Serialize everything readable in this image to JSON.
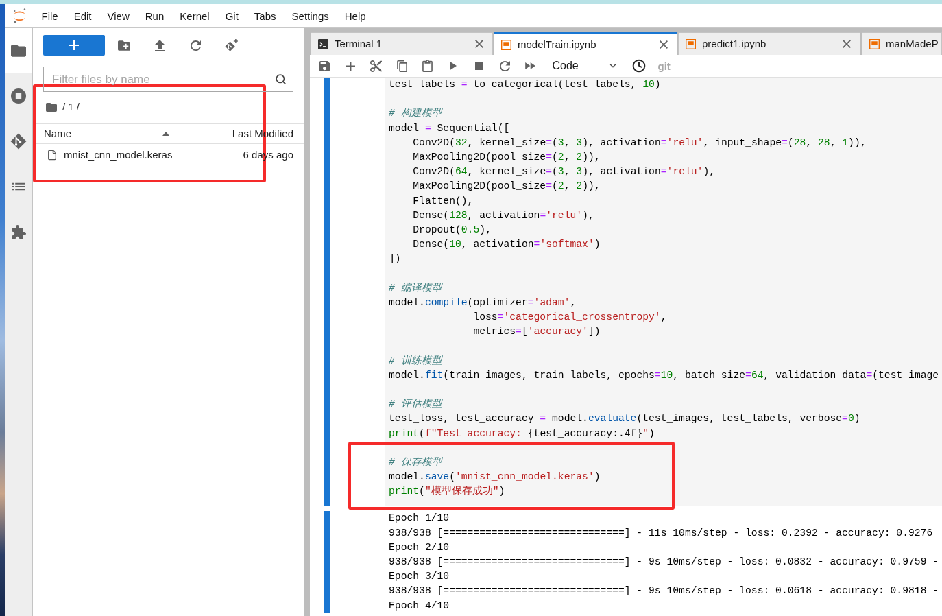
{
  "menu_bar": {
    "items": [
      "File",
      "Edit",
      "View",
      "Run",
      "Kernel",
      "Git",
      "Tabs",
      "Settings",
      "Help"
    ]
  },
  "activity_bar": {
    "items": [
      {
        "kind": "files",
        "selected": true
      },
      {
        "kind": "running",
        "selected": false
      },
      {
        "kind": "git",
        "selected": false
      },
      {
        "kind": "table_of_contents",
        "selected": false
      },
      {
        "kind": "extensions",
        "selected": false
      }
    ]
  },
  "file_browser": {
    "toolbar": [
      {
        "kind": "new_launcher"
      },
      {
        "kind": "new_folder"
      },
      {
        "kind": "upload"
      },
      {
        "kind": "refresh"
      },
      {
        "kind": "git_clone"
      }
    ],
    "filter": {
      "placeholder": "Filter files by name"
    },
    "path": "/ 1 /",
    "columns": [
      {
        "label": "Name",
        "sorted": true
      },
      {
        "label": "Last Modified",
        "sorted": false
      }
    ],
    "files": [
      {
        "name": "mnist_cnn_model.keras",
        "modified": "6 days ago",
        "selected": false
      }
    ]
  },
  "tabs": [
    {
      "kind": "terminal",
      "label": "Terminal 1",
      "selected": false,
      "closable": true
    },
    {
      "kind": "notebook",
      "label": "modelTrain.ipynb",
      "selected": true,
      "closable": true
    },
    {
      "kind": "notebook",
      "label": "predict1.ipynb",
      "selected": false,
      "closable": true
    },
    {
      "kind": "notebook",
      "label": "manMadeP",
      "selected": false,
      "closable": false
    }
  ],
  "notebook_toolbar": {
    "buttons": [
      {
        "kind": "save"
      },
      {
        "kind": "insert"
      },
      {
        "kind": "cut"
      },
      {
        "kind": "copy"
      },
      {
        "kind": "paste"
      },
      {
        "kind": "run"
      },
      {
        "kind": "interrupt"
      },
      {
        "kind": "restart"
      },
      {
        "kind": "run_all"
      }
    ],
    "cell_type": "Code",
    "extras": [
      {
        "kind": "history"
      },
      {
        "kind": "diff",
        "label": "git"
      }
    ]
  },
  "notebook": {
    "cells": [
      {
        "active": true,
        "input": [
          {
            "lines": [
              [
                {
                  "kind": "plain",
                  "text": "test_labels "
                },
                {
                  "kind": "operator",
                  "text": "="
                },
                {
                  "kind": "plain",
                  "text": " to_categorical(test_labels, "
                },
                {
                  "kind": "number",
                  "text": "10"
                },
                {
                  "kind": "plain",
                  "text": ")"
                }
              ]
            ]
          },
          {
            "lines": [
              [
                {
                  "kind": "comment",
                  "text": "# 构建模型"
                }
              ],
              [
                {
                  "kind": "plain",
                  "text": "model "
                },
                {
                  "kind": "operator",
                  "text": "="
                },
                {
                  "kind": "plain",
                  "text": " Sequential(["
                }
              ],
              [
                {
                  "kind": "plain",
                  "text": "    Conv2D("
                },
                {
                  "kind": "number",
                  "text": "32"
                },
                {
                  "kind": "plain",
                  "text": ", kernel_size"
                },
                {
                  "kind": "operator",
                  "text": "="
                },
                {
                  "kind": "plain",
                  "text": "("
                },
                {
                  "kind": "number",
                  "text": "3"
                },
                {
                  "kind": "plain",
                  "text": ", "
                },
                {
                  "kind": "number",
                  "text": "3"
                },
                {
                  "kind": "plain",
                  "text": "), activation"
                },
                {
                  "kind": "operator",
                  "text": "="
                },
                {
                  "kind": "string",
                  "text": "'relu'"
                },
                {
                  "kind": "plain",
                  "text": ", input_shape"
                },
                {
                  "kind": "operator",
                  "text": "="
                },
                {
                  "kind": "plain",
                  "text": "("
                },
                {
                  "kind": "number",
                  "text": "28"
                },
                {
                  "kind": "plain",
                  "text": ", "
                },
                {
                  "kind": "number",
                  "text": "28"
                },
                {
                  "kind": "plain",
                  "text": ", "
                },
                {
                  "kind": "number",
                  "text": "1"
                },
                {
                  "kind": "plain",
                  "text": ")),"
                }
              ],
              [
                {
                  "kind": "plain",
                  "text": "    MaxPooling2D(pool_size"
                },
                {
                  "kind": "operator",
                  "text": "="
                },
                {
                  "kind": "plain",
                  "text": "("
                },
                {
                  "kind": "number",
                  "text": "2"
                },
                {
                  "kind": "plain",
                  "text": ", "
                },
                {
                  "kind": "number",
                  "text": "2"
                },
                {
                  "kind": "plain",
                  "text": ")),"
                }
              ],
              [
                {
                  "kind": "plain",
                  "text": "    Conv2D("
                },
                {
                  "kind": "number",
                  "text": "64"
                },
                {
                  "kind": "plain",
                  "text": ", kernel_size"
                },
                {
                  "kind": "operator",
                  "text": "="
                },
                {
                  "kind": "plain",
                  "text": "("
                },
                {
                  "kind": "number",
                  "text": "3"
                },
                {
                  "kind": "plain",
                  "text": ", "
                },
                {
                  "kind": "number",
                  "text": "3"
                },
                {
                  "kind": "plain",
                  "text": "), activation"
                },
                {
                  "kind": "operator",
                  "text": "="
                },
                {
                  "kind": "string",
                  "text": "'relu'"
                },
                {
                  "kind": "plain",
                  "text": "),"
                }
              ],
              [
                {
                  "kind": "plain",
                  "text": "    MaxPooling2D(pool_size"
                },
                {
                  "kind": "operator",
                  "text": "="
                },
                {
                  "kind": "plain",
                  "text": "("
                },
                {
                  "kind": "number",
                  "text": "2"
                },
                {
                  "kind": "plain",
                  "text": ", "
                },
                {
                  "kind": "number",
                  "text": "2"
                },
                {
                  "kind": "plain",
                  "text": ")),"
                }
              ],
              [
                {
                  "kind": "plain",
                  "text": "    Flatten(),"
                }
              ],
              [
                {
                  "kind": "plain",
                  "text": "    Dense("
                },
                {
                  "kind": "number",
                  "text": "128"
                },
                {
                  "kind": "plain",
                  "text": ", activation"
                },
                {
                  "kind": "operator",
                  "text": "="
                },
                {
                  "kind": "string",
                  "text": "'relu'"
                },
                {
                  "kind": "plain",
                  "text": "),"
                }
              ],
              [
                {
                  "kind": "plain",
                  "text": "    Dropout("
                },
                {
                  "kind": "number",
                  "text": "0.5"
                },
                {
                  "kind": "plain",
                  "text": "),"
                }
              ],
              [
                {
                  "kind": "plain",
                  "text": "    Dense("
                },
                {
                  "kind": "number",
                  "text": "10"
                },
                {
                  "kind": "plain",
                  "text": ", activation"
                },
                {
                  "kind": "operator",
                  "text": "="
                },
                {
                  "kind": "string",
                  "text": "'softmax'"
                },
                {
                  "kind": "plain",
                  "text": ")"
                }
              ],
              [
                {
                  "kind": "plain",
                  "text": "])"
                }
              ]
            ]
          },
          {
            "lines": [
              [
                {
                  "kind": "comment",
                  "text": "# 编译模型"
                }
              ],
              [
                {
                  "kind": "plain",
                  "text": "model."
                },
                {
                  "kind": "method",
                  "text": "compile"
                },
                {
                  "kind": "plain",
                  "text": "(optimizer"
                },
                {
                  "kind": "operator",
                  "text": "="
                },
                {
                  "kind": "string",
                  "text": "'adam'"
                },
                {
                  "kind": "plain",
                  "text": ","
                }
              ],
              [
                {
                  "kind": "plain",
                  "text": "              loss"
                },
                {
                  "kind": "operator",
                  "text": "="
                },
                {
                  "kind": "string",
                  "text": "'categorical_crossentropy'"
                },
                {
                  "kind": "plain",
                  "text": ","
                }
              ],
              [
                {
                  "kind": "plain",
                  "text": "              metrics"
                },
                {
                  "kind": "operator",
                  "text": "="
                },
                {
                  "kind": "plain",
                  "text": "["
                },
                {
                  "kind": "string",
                  "text": "'accuracy'"
                },
                {
                  "kind": "plain",
                  "text": "])"
                }
              ]
            ]
          },
          {
            "lines": [
              [
                {
                  "kind": "comment",
                  "text": "# 训练模型"
                }
              ],
              [
                {
                  "kind": "plain",
                  "text": "model."
                },
                {
                  "kind": "method",
                  "text": "fit"
                },
                {
                  "kind": "plain",
                  "text": "(train_images, train_labels, epochs"
                },
                {
                  "kind": "operator",
                  "text": "="
                },
                {
                  "kind": "number",
                  "text": "10"
                },
                {
                  "kind": "plain",
                  "text": ", batch_size"
                },
                {
                  "kind": "operator",
                  "text": "="
                },
                {
                  "kind": "number",
                  "text": "64"
                },
                {
                  "kind": "plain",
                  "text": ", validation_data"
                },
                {
                  "kind": "operator",
                  "text": "="
                },
                {
                  "kind": "plain",
                  "text": "(test_image"
                }
              ]
            ]
          },
          {
            "lines": [
              [
                {
                  "kind": "comment",
                  "text": "# 评估模型"
                }
              ],
              [
                {
                  "kind": "plain",
                  "text": "test_loss, test_accuracy "
                },
                {
                  "kind": "operator",
                  "text": "="
                },
                {
                  "kind": "plain",
                  "text": " model."
                },
                {
                  "kind": "method",
                  "text": "evaluate"
                },
                {
                  "kind": "plain",
                  "text": "(test_images, test_labels, verbose"
                },
                {
                  "kind": "operator",
                  "text": "="
                },
                {
                  "kind": "number",
                  "text": "0"
                },
                {
                  "kind": "plain",
                  "text": ")"
                }
              ],
              [
                {
                  "kind": "builtin",
                  "text": "print"
                },
                {
                  "kind": "plain",
                  "text": "("
                },
                {
                  "kind": "string",
                  "text": "f\"Test accuracy: "
                },
                {
                  "kind": "plain",
                  "text": "{test_accuracy:.4f}"
                },
                {
                  "kind": "string",
                  "text": "\""
                },
                {
                  "kind": "plain",
                  "text": ")"
                }
              ]
            ]
          },
          {
            "lines": [
              [
                {
                  "kind": "comment",
                  "text": "# 保存模型"
                }
              ],
              [
                {
                  "kind": "plain",
                  "text": "model."
                },
                {
                  "kind": "method",
                  "text": "save"
                },
                {
                  "kind": "plain",
                  "text": "("
                },
                {
                  "kind": "string",
                  "text": "'mnist_cnn_model.keras'"
                },
                {
                  "kind": "plain",
                  "text": ")"
                }
              ],
              [
                {
                  "kind": "builtin",
                  "text": "print"
                },
                {
                  "kind": "plain",
                  "text": "("
                },
                {
                  "kind": "string",
                  "text": "\"模型保存成功\""
                },
                {
                  "kind": "plain",
                  "text": ")"
                }
              ]
            ]
          }
        ],
        "outputs": [
          "Epoch 1/10",
          "938/938 [==============================] - 11s 10ms/step - loss: 0.2392 - accuracy: 0.9276",
          "Epoch 2/10",
          "938/938 [==============================] - 9s 10ms/step - loss: 0.0832 - accuracy: 0.9759 -",
          "Epoch 3/10",
          "938/938 [==============================] - 9s 10ms/step - loss: 0.0618 - accuracy: 0.9818 -",
          "Epoch 4/10"
        ]
      }
    ]
  },
  "annotations": [
    {
      "kind": "frame"
    },
    {
      "kind": "frame"
    }
  ]
}
